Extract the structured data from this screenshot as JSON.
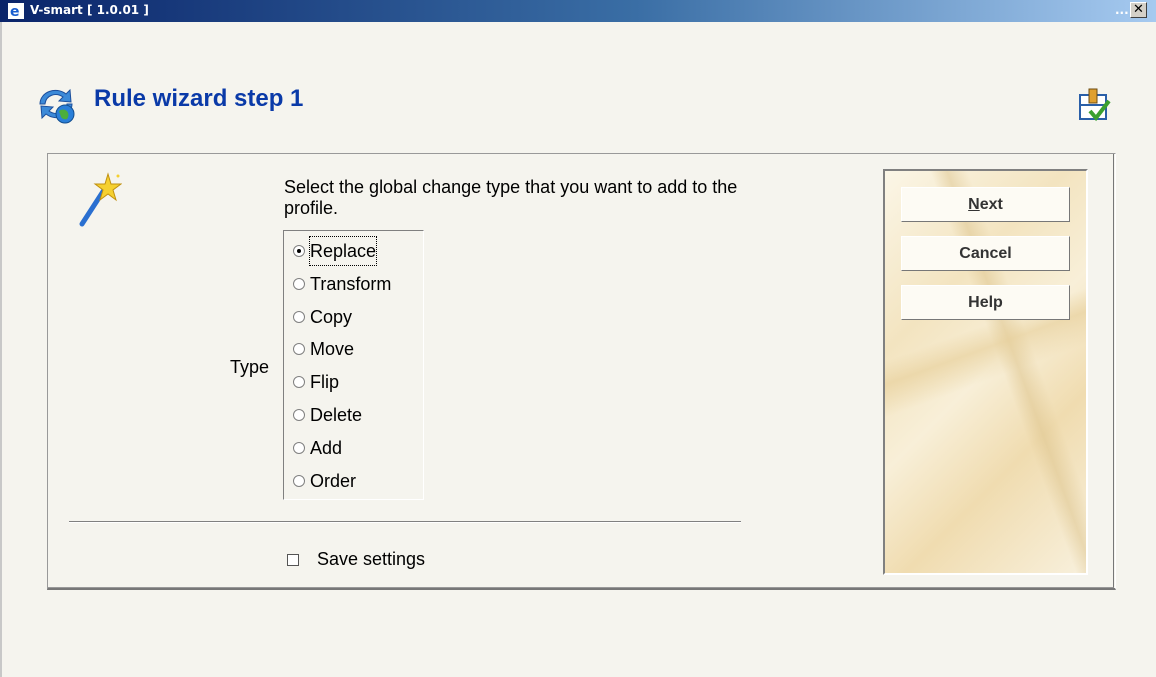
{
  "window": {
    "title": "V-smart [ 1.0.01 ]",
    "minimize_label": "...",
    "close_label": "✕"
  },
  "page": {
    "title": "Rule wizard step 1",
    "icon": "rule-refresh-globe-icon",
    "right_icon": "workflow-check-icon"
  },
  "form": {
    "instructions": "Select the global change type that you want to add to the profile.",
    "type_label": "Type",
    "options": [
      "Replace",
      "Transform",
      "Copy",
      "Move",
      "Flip",
      "Delete",
      "Add",
      "Order"
    ],
    "selected": "Replace",
    "save_settings_label": "Save settings",
    "save_settings_checked": false
  },
  "buttons": {
    "next_accel": "N",
    "next_rest": "ext",
    "cancel": "Cancel",
    "help": "Help"
  },
  "colors": {
    "title_blue": "#0a3aa8",
    "titlebar_start": "#0a246a",
    "titlebar_end": "#a6caf0"
  }
}
